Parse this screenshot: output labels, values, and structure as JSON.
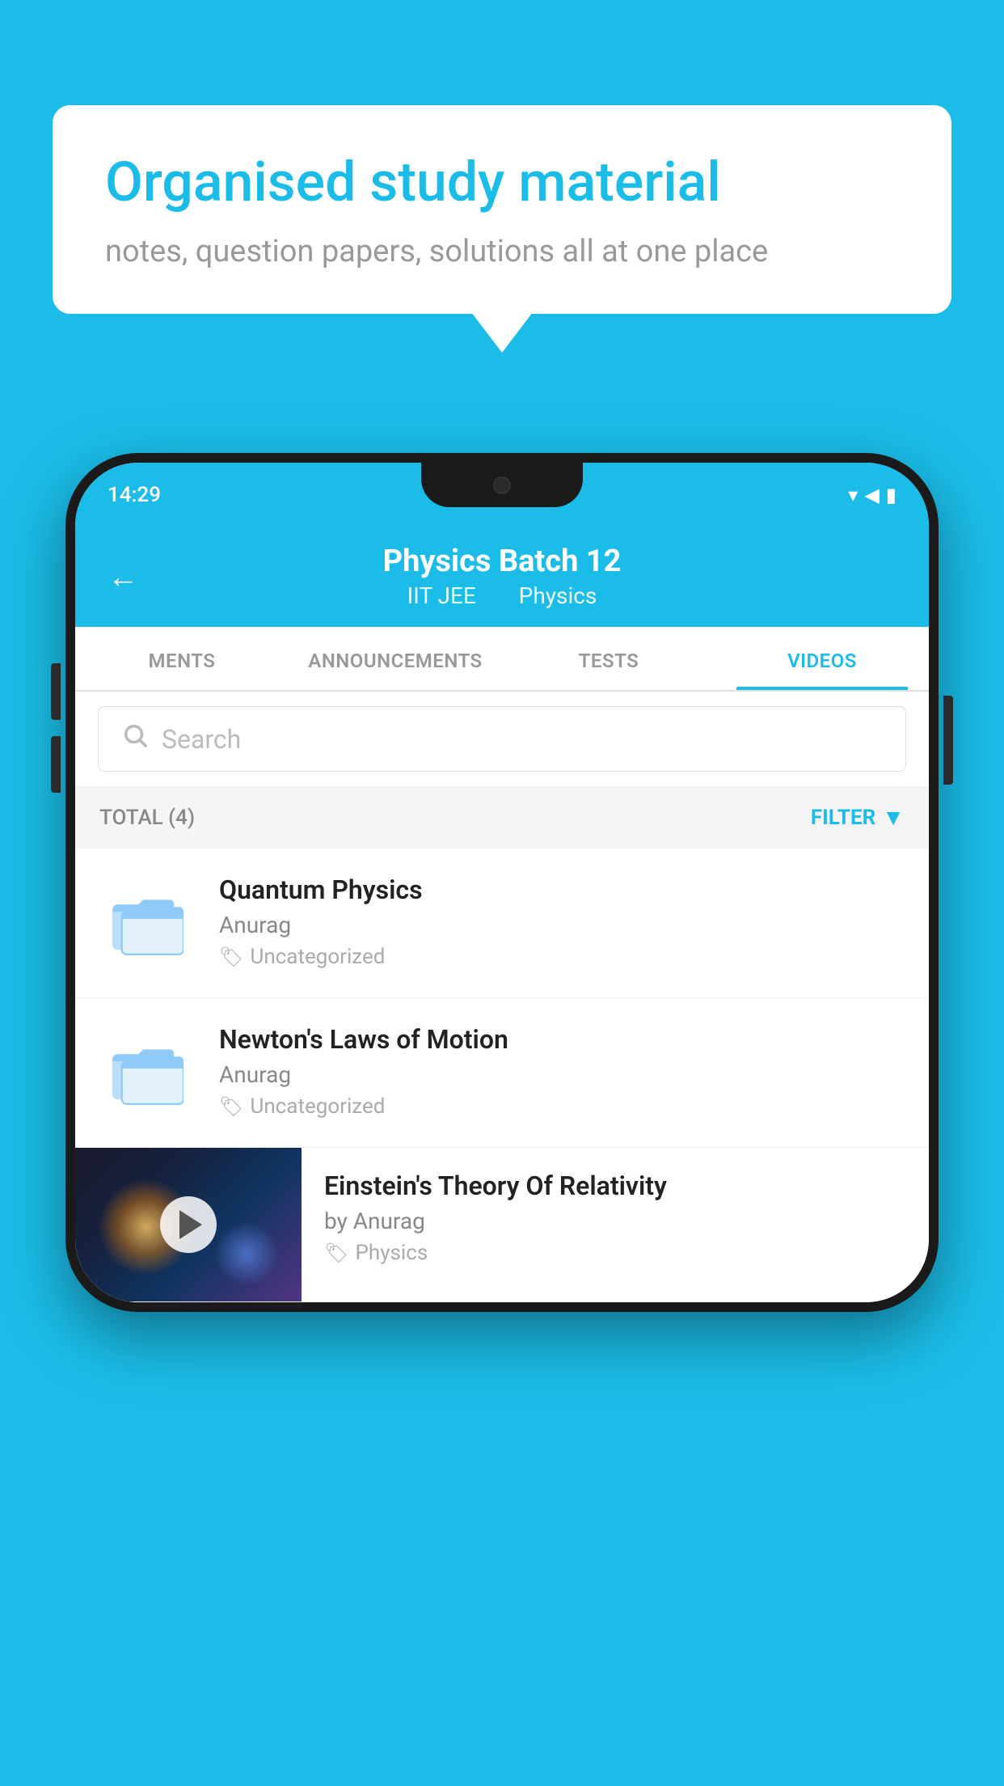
{
  "background": {
    "color": "#1bbde8"
  },
  "speechBubble": {
    "title": "Organised study material",
    "subtitle": "notes, question papers, solutions all at one place"
  },
  "phone": {
    "statusBar": {
      "time": "14:29"
    },
    "header": {
      "title": "Physics Batch 12",
      "subtitle1": "IIT JEE",
      "subtitle2": "Physics",
      "backLabel": "←"
    },
    "tabs": [
      {
        "label": "MENTS",
        "active": false
      },
      {
        "label": "ANNOUNCEMENTS",
        "active": false
      },
      {
        "label": "TESTS",
        "active": false
      },
      {
        "label": "VIDEOS",
        "active": true
      }
    ],
    "search": {
      "placeholder": "Search"
    },
    "filterBar": {
      "total": "TOTAL (4)",
      "filterLabel": "FILTER"
    },
    "videos": [
      {
        "id": 1,
        "title": "Quantum Physics",
        "author": "Anurag",
        "tag": "Uncategorized",
        "hasThumb": false
      },
      {
        "id": 2,
        "title": "Newton's Laws of Motion",
        "author": "Anurag",
        "tag": "Uncategorized",
        "hasThumb": false
      },
      {
        "id": 3,
        "title": "Einstein's Theory Of Relativity",
        "author": "by Anurag",
        "tag": "Physics",
        "hasThumb": true
      }
    ]
  }
}
